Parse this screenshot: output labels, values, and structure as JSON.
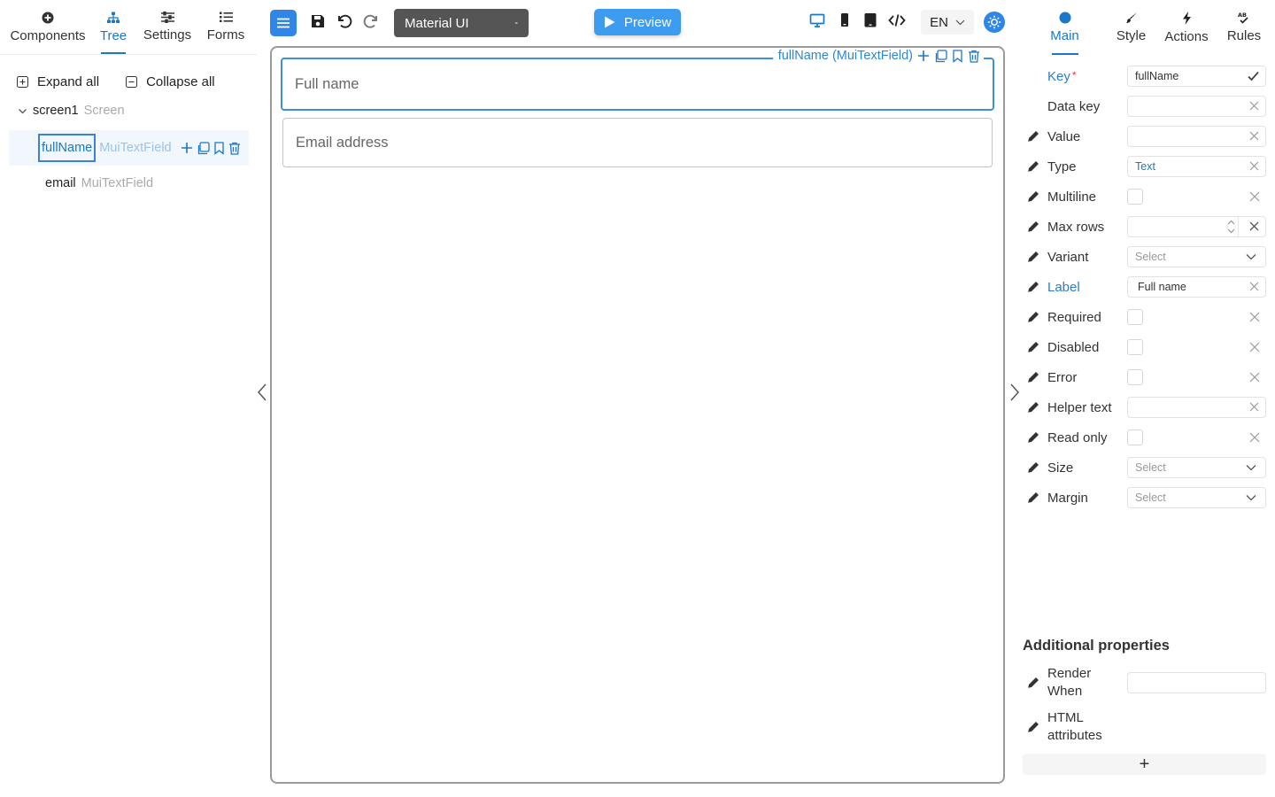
{
  "left": {
    "tabs": [
      {
        "label": "Components",
        "icon": "plus-circle-icon"
      },
      {
        "label": "Tree",
        "icon": "sitemap-icon",
        "active": true
      },
      {
        "label": "Settings",
        "icon": "sliders-icon"
      },
      {
        "label": "Forms",
        "icon": "list-icon"
      }
    ],
    "expand_all": "Expand all",
    "collapse_all": "Collapse all",
    "root": {
      "key": "screen1",
      "type": "Screen"
    },
    "nodes": [
      {
        "key": "fullName",
        "type": "MuiTextField",
        "selected": true
      },
      {
        "key": "email",
        "type": "MuiTextField",
        "selected": false
      }
    ]
  },
  "toolbar": {
    "library": "Material UI",
    "library_caret": "-",
    "preview": "Preview",
    "language": "EN"
  },
  "canvas": {
    "fields": [
      {
        "label": "Full name",
        "selected": true
      },
      {
        "label": "Email address",
        "selected": false
      }
    ],
    "selection_tag": "fullName (MuiTextField)"
  },
  "right": {
    "tabs": [
      {
        "label": "Main",
        "icon": "circle-icon",
        "active": true
      },
      {
        "label": "Style",
        "icon": "brush-icon"
      },
      {
        "label": "Actions",
        "icon": "bolt-icon"
      },
      {
        "label": "Rules",
        "icon": "rules-icon"
      }
    ],
    "props": {
      "key": {
        "label": "Key",
        "required_mark": "*",
        "value": "fullName"
      },
      "data_key": {
        "label": "Data key",
        "value": ""
      },
      "value": {
        "label": "Value",
        "value": ""
      },
      "type": {
        "label": "Type",
        "value": "Text"
      },
      "multiline": {
        "label": "Multiline"
      },
      "max_rows": {
        "label": "Max rows",
        "value": ""
      },
      "variant": {
        "label": "Variant",
        "placeholder": "Select"
      },
      "label": {
        "label": "Label",
        "value": "Full name"
      },
      "required": {
        "label": "Required"
      },
      "disabled": {
        "label": "Disabled"
      },
      "error": {
        "label": "Error"
      },
      "helper_text": {
        "label": "Helper text",
        "value": ""
      },
      "read_only": {
        "label": "Read only"
      },
      "size": {
        "label": "Size",
        "placeholder": "Select"
      },
      "margin": {
        "label": "Margin",
        "placeholder": "Select"
      }
    },
    "additional": {
      "title": "Additional properties",
      "render_when": {
        "label_line1": "Render",
        "label_line2": "When",
        "value": ""
      },
      "html_attributes": {
        "label_line1": "HTML",
        "label_line2": "attributes"
      },
      "add_label": "+"
    }
  },
  "colors": {
    "accent": "#1b78c8",
    "primary_btn": "#2f86e6",
    "preview_btn": "#3d9bf0",
    "library_bg": "#555555"
  }
}
